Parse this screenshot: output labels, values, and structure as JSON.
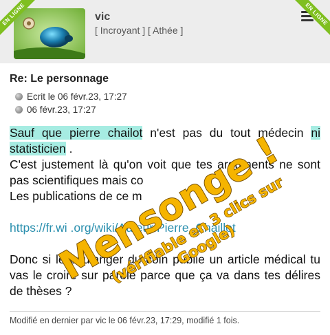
{
  "header": {
    "online_badge_left": "EN LIGNE",
    "online_badge_right": "EN LIGNE",
    "username": "vic",
    "rank": "[ Incroyant ] [ Athée ]",
    "menu_icon": "hamburger-menu-icon"
  },
  "post": {
    "title": "Re: Le personnage",
    "written_line": "Ecrit le 06 févr.23, 17:27",
    "date_line": "06 févr.23, 17:27",
    "p1_hl1": "Sauf que pierre chailot",
    "p1_mid": " n'est pas du tout médecin ",
    "p1_hl2": "ni statisticien",
    "p1_end": " .",
    "p2": "C'est justement là qu'on voit que tes arguments ne sont pas scientifiques mais co",
    "p3": "Les publications de ce m",
    "link": "https://fr.wi            .org/wiki/Auteur:Pierre_Chaillot",
    "p4": "Donc si le boulanger du coin publie un article médical tu vas le croire sur parole parce que ça va dans tes délires de thèses ?"
  },
  "overlay": {
    "stamp_main": "Mensonge !",
    "stamp_sub_line1": "(vérifiable en 3 clics sur",
    "stamp_sub_line2": "Google)",
    "stamp_color": "#f5b400"
  },
  "footer": {
    "modified": "Modifié en dernier par vic le 06 févr.23, 17:29, modifié 1 fois."
  }
}
